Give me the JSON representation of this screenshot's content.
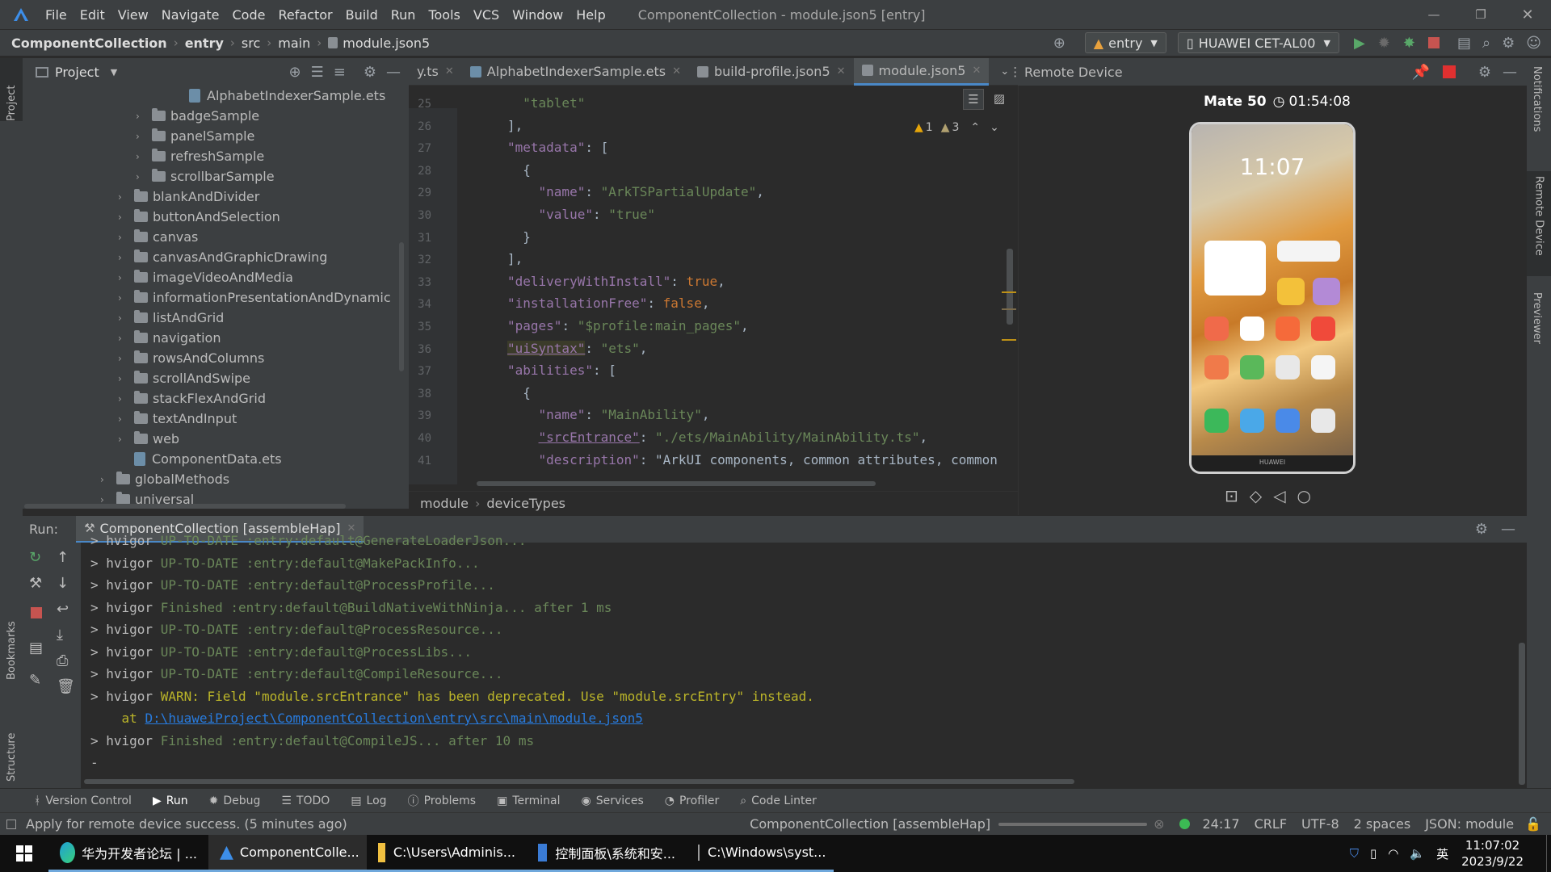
{
  "window": {
    "menu": [
      "File",
      "Edit",
      "View",
      "Navigate",
      "Code",
      "Refactor",
      "Build",
      "Run",
      "Tools",
      "VCS",
      "Window",
      "Help"
    ],
    "title": "ComponentCollection - module.json5 [entry]"
  },
  "navbar": {
    "breadcrumb": [
      "ComponentCollection",
      "entry",
      "src",
      "main",
      "module.json5"
    ],
    "run_config": "entry",
    "device": "HUAWEI CET-AL00"
  },
  "left_strip": {
    "project": "Project",
    "bookmarks": "Bookmarks",
    "structure": "Structure"
  },
  "right_strip": {
    "notifications": "Notifications",
    "remote_device": "Remote Device",
    "previewer": "Previewer"
  },
  "project_panel": {
    "title": "Project",
    "tree": [
      {
        "label": "AlphabetIndexerSample.ets",
        "type": "file",
        "depth": 3,
        "expandable": false
      },
      {
        "label": "badgeSample",
        "type": "folder",
        "depth": 2,
        "expandable": true
      },
      {
        "label": "panelSample",
        "type": "folder",
        "depth": 2,
        "expandable": true
      },
      {
        "label": "refreshSample",
        "type": "folder",
        "depth": 2,
        "expandable": true
      },
      {
        "label": "scrollbarSample",
        "type": "folder",
        "depth": 2,
        "expandable": true
      },
      {
        "label": "blankAndDivider",
        "type": "folder",
        "depth": 1,
        "expandable": true
      },
      {
        "label": "buttonAndSelection",
        "type": "folder",
        "depth": 1,
        "expandable": true
      },
      {
        "label": "canvas",
        "type": "folder",
        "depth": 1,
        "expandable": true
      },
      {
        "label": "canvasAndGraphicDrawing",
        "type": "folder",
        "depth": 1,
        "expandable": true
      },
      {
        "label": "imageVideoAndMedia",
        "type": "folder",
        "depth": 1,
        "expandable": true
      },
      {
        "label": "informationPresentationAndDynamic",
        "type": "folder",
        "depth": 1,
        "expandable": true
      },
      {
        "label": "listAndGrid",
        "type": "folder",
        "depth": 1,
        "expandable": true
      },
      {
        "label": "navigation",
        "type": "folder",
        "depth": 1,
        "expandable": true
      },
      {
        "label": "rowsAndColumns",
        "type": "folder",
        "depth": 1,
        "expandable": true
      },
      {
        "label": "scrollAndSwipe",
        "type": "folder",
        "depth": 1,
        "expandable": true
      },
      {
        "label": "stackFlexAndGrid",
        "type": "folder",
        "depth": 1,
        "expandable": true
      },
      {
        "label": "textAndInput",
        "type": "folder",
        "depth": 1,
        "expandable": true
      },
      {
        "label": "web",
        "type": "folder",
        "depth": 1,
        "expandable": true
      },
      {
        "label": "ComponentData.ets",
        "type": "file",
        "depth": 1,
        "expandable": false
      },
      {
        "label": "globalMethods",
        "type": "folder",
        "depth": 0,
        "expandable": true
      },
      {
        "label": "universal",
        "type": "folder",
        "depth": 0,
        "expandable": true
      }
    ]
  },
  "editor": {
    "tabs": [
      {
        "label": "y.ts",
        "active": false
      },
      {
        "label": "AlphabetIndexerSample.ets",
        "active": false
      },
      {
        "label": "build-profile.json5",
        "active": false
      },
      {
        "label": "module.json5",
        "active": true
      }
    ],
    "warnings": "1",
    "weak_warnings": "3",
    "lines": [
      {
        "n": "25",
        "text": "  \"tablet\""
      },
      {
        "n": "26",
        "text": "],"
      },
      {
        "n": "27",
        "text": "\"metadata\": ["
      },
      {
        "n": "28",
        "text": "  {"
      },
      {
        "n": "29",
        "text": "    \"name\": \"ArkTSPartialUpdate\","
      },
      {
        "n": "30",
        "text": "    \"value\": \"true\""
      },
      {
        "n": "31",
        "text": "  }"
      },
      {
        "n": "32",
        "text": "],"
      },
      {
        "n": "33",
        "text": "\"deliveryWithInstall\": true,"
      },
      {
        "n": "34",
        "text": "\"installationFree\": false,"
      },
      {
        "n": "35",
        "text": "\"pages\": \"$profile:main_pages\","
      },
      {
        "n": "36",
        "text": "\"uiSyntax\": \"ets\","
      },
      {
        "n": "37",
        "text": "\"abilities\": ["
      },
      {
        "n": "38",
        "text": "  {"
      },
      {
        "n": "39",
        "text": "    \"name\": \"MainAbility\","
      },
      {
        "n": "40",
        "text": "    \"srcEntrance\": \"./ets/MainAbility/MainAbility.ts\","
      },
      {
        "n": "41",
        "text": "    \"description\": \"ArkUI components, common attributes, common"
      }
    ],
    "breadcrumb": [
      "module",
      "deviceTypes"
    ]
  },
  "remote_device": {
    "title": "Remote Device",
    "device_name": "Mate 50",
    "timer": "01:54:08",
    "phone_time": "11:07",
    "phone_brand": "HUAWEI"
  },
  "run_panel": {
    "label": "Run:",
    "tab": "ComponentCollection [assembleHap]",
    "lines": [
      {
        "prefix": "> hvigor ",
        "status": "UP-TO-DATE",
        "rest": " :entry:default@GenerateLoaderJson...",
        "kind": "green"
      },
      {
        "prefix": "> hvigor ",
        "status": "UP-TO-DATE",
        "rest": " :entry:default@MakePackInfo...",
        "kind": "green"
      },
      {
        "prefix": "> hvigor ",
        "status": "UP-TO-DATE",
        "rest": " :entry:default@ProcessProfile...",
        "kind": "green"
      },
      {
        "prefix": "> hvigor ",
        "status": "Finished",
        "rest": " :entry:default@BuildNativeWithNinja... after 1 ms",
        "kind": "green"
      },
      {
        "prefix": "> hvigor ",
        "status": "UP-TO-DATE",
        "rest": " :entry:default@ProcessResource...",
        "kind": "green"
      },
      {
        "prefix": "> hvigor ",
        "status": "UP-TO-DATE",
        "rest": " :entry:default@ProcessLibs...",
        "kind": "green"
      },
      {
        "prefix": "> hvigor ",
        "status": "UP-TO-DATE",
        "rest": " :entry:default@CompileResource...",
        "kind": "green"
      },
      {
        "prefix": "> hvigor ",
        "status": "WARN:",
        "rest": " Field \"module.srcEntrance\" has been deprecated. Use \"module.srcEntry\" instead.",
        "kind": "warn"
      },
      {
        "prefix": "    at ",
        "status": "",
        "rest": "D:\\huaweiProject\\ComponentCollection\\entry\\src\\main\\module.json5",
        "kind": "link"
      },
      {
        "prefix": "> hvigor ",
        "status": "Finished",
        "rest": " :entry:default@CompileJS... after 10 ms",
        "kind": "green"
      },
      {
        "prefix": "-",
        "status": "",
        "rest": "",
        "kind": "plain"
      }
    ]
  },
  "tool_tabs": [
    "Version Control",
    "Run",
    "Debug",
    "TODO",
    "Log",
    "Problems",
    "Terminal",
    "Services",
    "Profiler",
    "Code Linter"
  ],
  "status_bar": {
    "message": "Apply for remote device success. (5 minutes ago)",
    "task": "ComponentCollection [assembleHap]",
    "position": "24:17",
    "line_sep": "CRLF",
    "encoding": "UTF-8",
    "indent": "2 spaces",
    "schema": "JSON: module"
  },
  "taskbar": {
    "items": [
      {
        "label": "华为开发者论坛 | ...",
        "active": false
      },
      {
        "label": "ComponentColle...",
        "active": true
      },
      {
        "label": "C:\\Users\\Adminis...",
        "active": false
      },
      {
        "label": "控制面板\\系统和安...",
        "active": false
      },
      {
        "label": "C:\\Windows\\syst...",
        "active": false
      }
    ],
    "ime": "英",
    "time": "11:07:02",
    "date": "2023/9/22"
  }
}
